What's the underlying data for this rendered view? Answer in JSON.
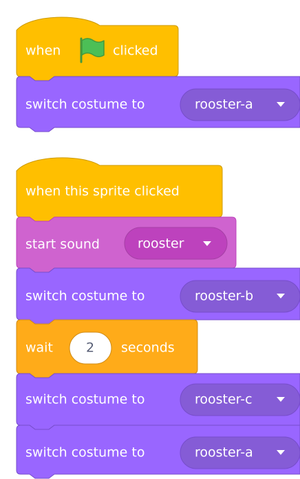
{
  "colors": {
    "events": "#FFBF00",
    "events_stroke": "#CC9900",
    "looks": "#9966FF",
    "looks_stroke": "#774DCB",
    "looks_dropdown": "#855CD6",
    "sound": "#CF63CF",
    "sound_stroke": "#BD42BD",
    "sound_dropdown": "#BD42BD",
    "control": "#FFAB19",
    "control_stroke": "#CF8B17",
    "flag": "#4CBF56",
    "flag_stroke": "#45993D"
  },
  "script1": {
    "hat": {
      "when": "when",
      "flag_icon": "green-flag-icon",
      "clicked": "clicked"
    },
    "switch1": {
      "label": "switch costume to",
      "value": "rooster-a"
    }
  },
  "script2": {
    "hat": {
      "label": "when this sprite clicked"
    },
    "sound": {
      "label": "start sound",
      "value": "rooster"
    },
    "switch1": {
      "label": "switch costume to",
      "value": "rooster-b"
    },
    "wait": {
      "label": "wait",
      "value": "2",
      "unit": "seconds"
    },
    "switch2": {
      "label": "switch costume to",
      "value": "rooster-c"
    },
    "switch3": {
      "label": "switch costume to",
      "value": "rooster-a"
    }
  }
}
